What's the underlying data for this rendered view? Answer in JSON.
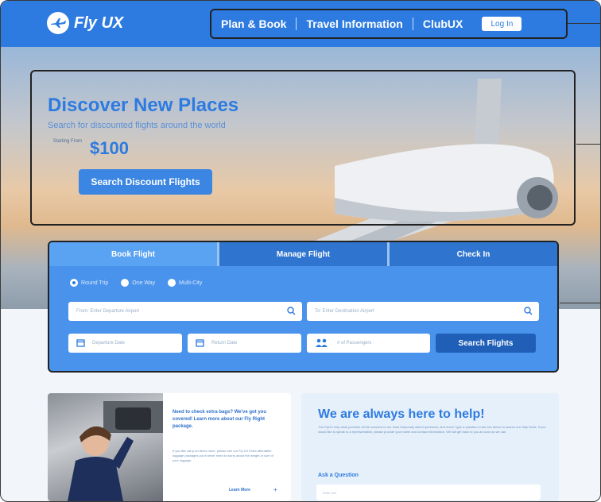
{
  "header": {
    "brand": "Fly UX",
    "nav": [
      "Plan & Book",
      "Travel Information",
      "ClubUX"
    ],
    "login_label": "Log In"
  },
  "hero": {
    "title": "Discover New Places",
    "subtitle": "Search for discounted flights around the world",
    "starting_from": "Starting From",
    "price": "$100",
    "cta": "Search Discount Flights"
  },
  "booking": {
    "tabs": [
      "Book Flight",
      "Manage Flight",
      "Check In"
    ],
    "active_tab": "Book Flight",
    "trip_types": [
      "Round Trip",
      "One Way",
      "Multi-City"
    ],
    "selected_trip_type": "Round Trip",
    "from_placeholder": "From: Enter Departure Airport",
    "to_placeholder": "To: Enter Destination Airport",
    "departure_placeholder": "Departure Date",
    "return_placeholder": "Return Date",
    "passengers_placeholder": "# of Passengers",
    "search_label": "Search Flights"
  },
  "promo": {
    "title": "Need to check extra bags? We've got you covered! Learn more about our Fly Right package.",
    "body": "If you like carry-on items more, please see our Fly UX Extra affordable luggage packages you'll never need to worry about the weight or size of your luggage.",
    "learn_more": "Learn More",
    "learn_more_icon": "+"
  },
  "help": {
    "title": "We are always here to help!",
    "body": "The FlyUX help desk provides all the answers to our most frequently asked questions, and more! Type a question in the box below to search our Help Desk. If you would like to speak to a representative, please provide your name and contact information. We will get back to you as soon as we can.",
    "ask_label": "Ask a Question",
    "ask_placeholder": "Enter text"
  },
  "colors": {
    "brand_blue": "#2d7be0",
    "booking_panel": "#4a93ec",
    "search_button": "#1f5fb8"
  }
}
